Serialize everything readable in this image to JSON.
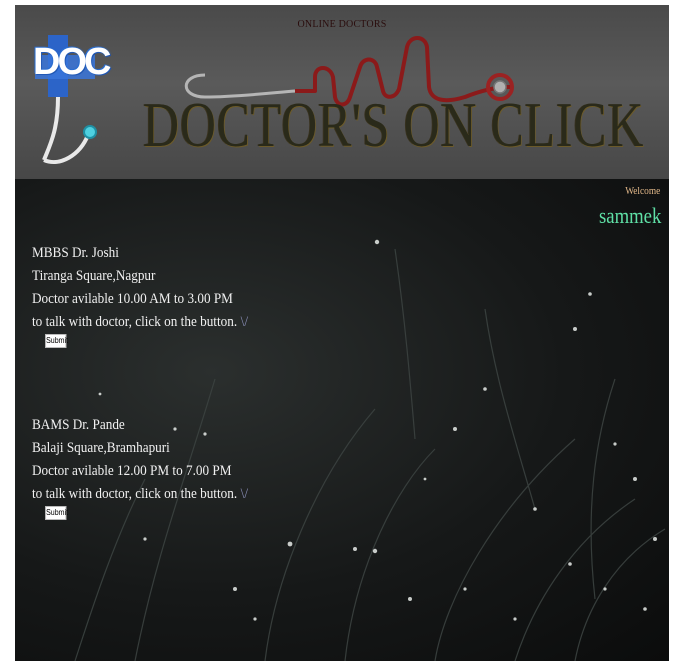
{
  "header": {
    "tagline": "ONLINE DOCTORS",
    "logo_text": "DOC",
    "brand_title": "DOCTOR'S ON CLICK"
  },
  "user": {
    "welcome_label": "Welcome",
    "username": "sammek"
  },
  "doctors": [
    {
      "title": "MBBS Dr. Joshi",
      "address": "Tiranga Square,Nagpur",
      "availability": "Doctor avilable 10.00 AM to 3.00 PM",
      "instruction": "to talk with doctor, click on the button.",
      "mark": "\\/",
      "button_label": "Submit"
    },
    {
      "title": "BAMS Dr. Pande",
      "address": "Balaji Square,Bramhapuri",
      "availability": "Doctor avilable 12.00 PM to 7.00 PM",
      "instruction": "to talk with doctor, click on the button.",
      "mark": "\\/",
      "button_label": "Submit"
    }
  ],
  "colors": {
    "header_bg": "#555555",
    "page_bg": "#141616",
    "username": "#5fe0a6",
    "welcome": "#e3b98a",
    "stethoscope": "#8b1a1a"
  }
}
